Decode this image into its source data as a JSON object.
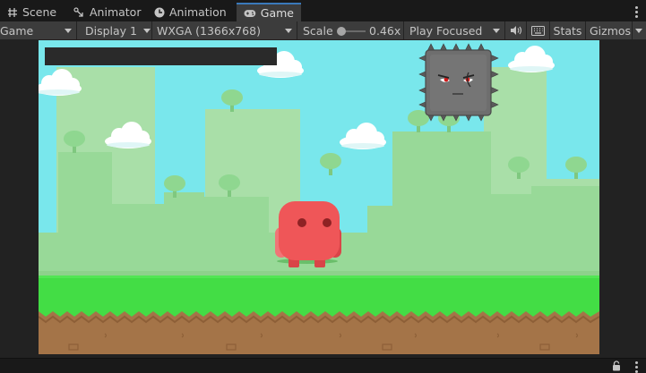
{
  "tabs": [
    {
      "label": "Scene",
      "icon": "grid-icon"
    },
    {
      "label": "Animator",
      "icon": "animator-icon"
    },
    {
      "label": "Animation",
      "icon": "clock-icon"
    },
    {
      "label": "Game",
      "icon": "gamepad-icon",
      "active": true
    }
  ],
  "toolbar": {
    "view": "Game",
    "display": "Display 1",
    "resolution": "WXGA (1366x768)",
    "scale_label": "Scale",
    "scale_value": "0.46x",
    "play_mode": "Play Focused",
    "stats": "Stats",
    "gizmos": "Gizmos"
  },
  "colors": {
    "sky": "#79e7ec",
    "grass": "#43dd45",
    "dirt": "#a47448",
    "player": "#ef5658",
    "spike_block": "#6e6e6e",
    "health_bar": "#2a2a2a"
  }
}
